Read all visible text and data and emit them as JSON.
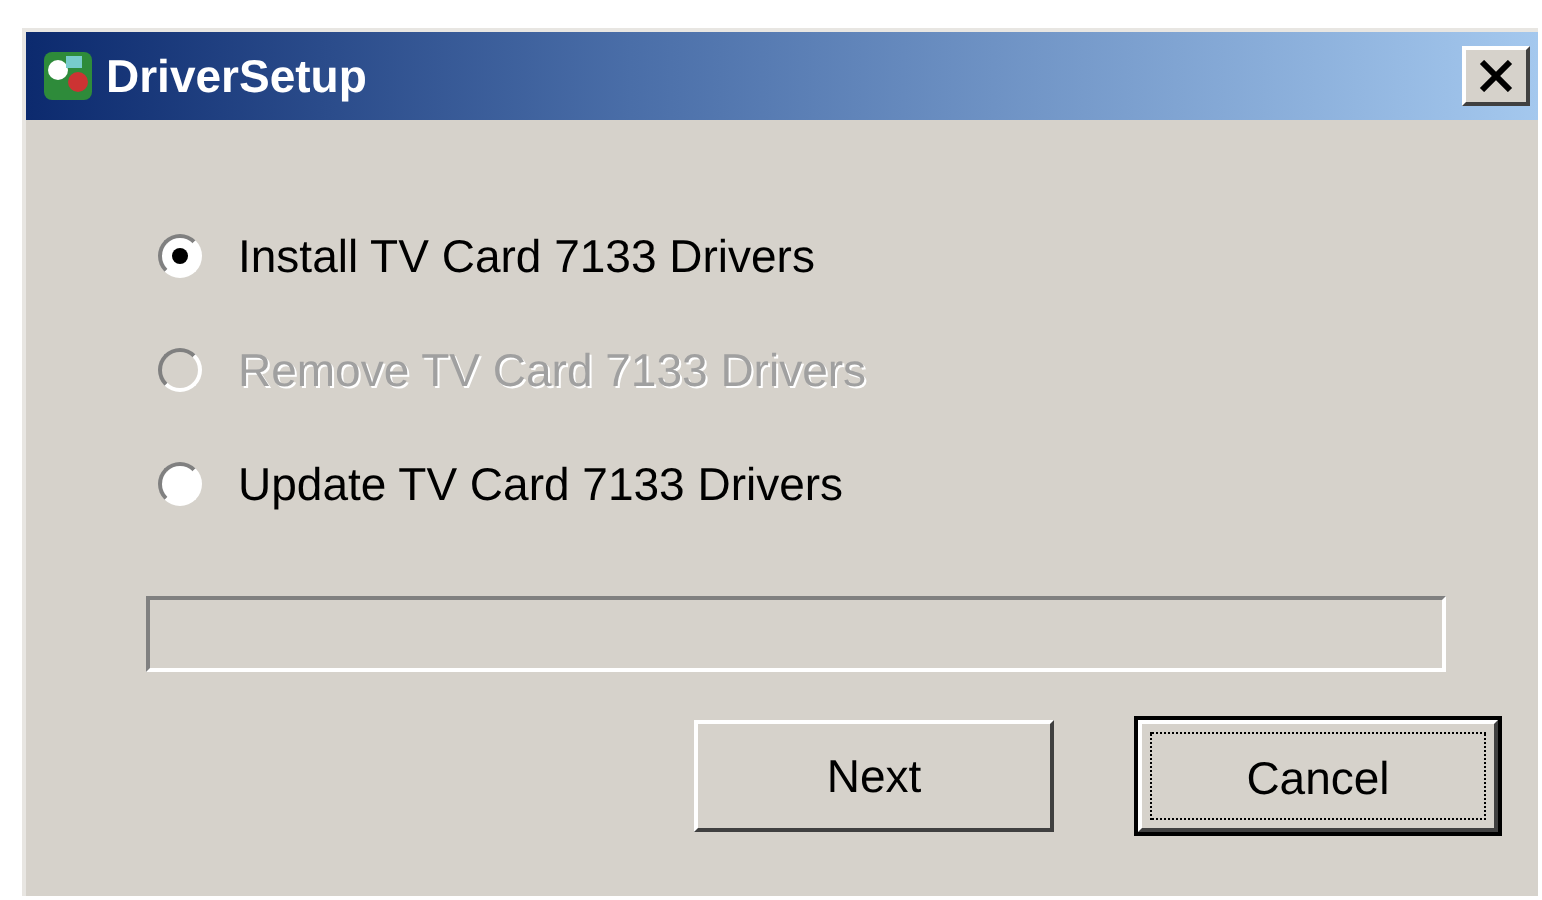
{
  "window": {
    "title": "DriverSetup"
  },
  "options": [
    {
      "label": "Install TV Card 7133 Drivers",
      "selected": true,
      "disabled": false
    },
    {
      "label": "Remove TV Card 7133 Drivers",
      "selected": false,
      "disabled": true
    },
    {
      "label": "Update TV Card 7133 Drivers",
      "selected": false,
      "disabled": false
    }
  ],
  "buttons": [
    {
      "label": "Next",
      "focused": false
    },
    {
      "label": "Cancel",
      "focused": true
    }
  ]
}
